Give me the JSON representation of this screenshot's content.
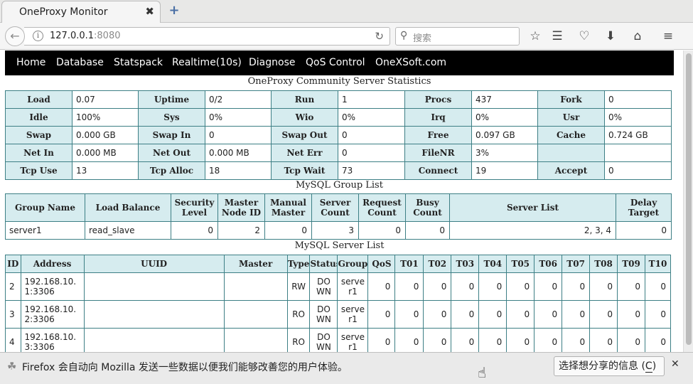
{
  "browser": {
    "tab_title": "OneProxy Monitor",
    "tab_close": "✖",
    "new_tab": "+",
    "url_host": "127.0.0.1",
    "url_port": ":8080",
    "search_placeholder": "搜索"
  },
  "menu": [
    "Home",
    "Database",
    "Statspack",
    "Realtime(10s)",
    "Diagnose",
    "QoS Control",
    "OneXSoft.com"
  ],
  "server_stats": {
    "caption": "OneProxy Community Server Statistics",
    "rows": [
      [
        [
          "Load",
          "0.07"
        ],
        [
          "Uptime",
          "0/2"
        ],
        [
          "Run",
          "1"
        ],
        [
          "Procs",
          "437"
        ],
        [
          "Fork",
          "0"
        ]
      ],
      [
        [
          "Idle",
          "100%"
        ],
        [
          "Sys",
          "0%"
        ],
        [
          "Wio",
          "0%"
        ],
        [
          "Irq",
          "0%"
        ],
        [
          "Usr",
          "0%"
        ]
      ],
      [
        [
          "Swap",
          "0.000 GB"
        ],
        [
          "Swap In",
          "0"
        ],
        [
          "Swap Out",
          "0"
        ],
        [
          "Free",
          "0.097 GB"
        ],
        [
          "Cache",
          "0.724 GB"
        ]
      ],
      [
        [
          "Net In",
          "0.000 MB"
        ],
        [
          "Net Out",
          "0.000 MB"
        ],
        [
          "Net Err",
          "0"
        ],
        [
          "FileNR",
          "3%"
        ],
        [
          "",
          ""
        ]
      ],
      [
        [
          "Tcp Use",
          "13"
        ],
        [
          "Tcp Alloc",
          "18"
        ],
        [
          "Tcp Wait",
          "73"
        ],
        [
          "Connect",
          "19"
        ],
        [
          "Accept",
          "0"
        ]
      ]
    ]
  },
  "group_list": {
    "caption": "MySQL Group List",
    "headers": [
      "Group Name",
      "Load Balance",
      "Security Level",
      "Master Node ID",
      "Manual Master",
      "Server Count",
      "Request Count",
      "Busy Count",
      "Server List",
      "Delay Target"
    ],
    "rows": [
      [
        "server1",
        "read_slave",
        "0",
        "2",
        "0",
        "3",
        "0",
        "0",
        "2, 3, 4",
        "0"
      ]
    ]
  },
  "server_list": {
    "caption": "MySQL Server List",
    "headers": [
      "ID",
      "Address",
      "UUID",
      "Master",
      "Type",
      "Status",
      "Group",
      "QoS",
      "T01",
      "T02",
      "T03",
      "T04",
      "T05",
      "T06",
      "T07",
      "T08",
      "T09",
      "T10"
    ],
    "rows": [
      [
        "2",
        "192.168.10.1:3306",
        "",
        "",
        "RW",
        "DOWN",
        "server1",
        "0",
        "0",
        "0",
        "0",
        "0",
        "0",
        "0",
        "0",
        "0",
        "0",
        "0"
      ],
      [
        "3",
        "192.168.10.2:3306",
        "",
        "",
        "RO",
        "DOWN",
        "server1",
        "0",
        "0",
        "0",
        "0",
        "0",
        "0",
        "0",
        "0",
        "0",
        "0",
        "0"
      ],
      [
        "4",
        "192.168.10.3:3306",
        "",
        "",
        "RO",
        "DOWN",
        "server1",
        "0",
        "0",
        "0",
        "0",
        "0",
        "0",
        "0",
        "0",
        "0",
        "0",
        "0"
      ]
    ]
  },
  "notification": {
    "text": "Firefox 会自动向 Mozilla 发送一些数据以便我们能够改善您的用户体验。",
    "button_label": "选择想分享的信息",
    "button_key": "C"
  }
}
